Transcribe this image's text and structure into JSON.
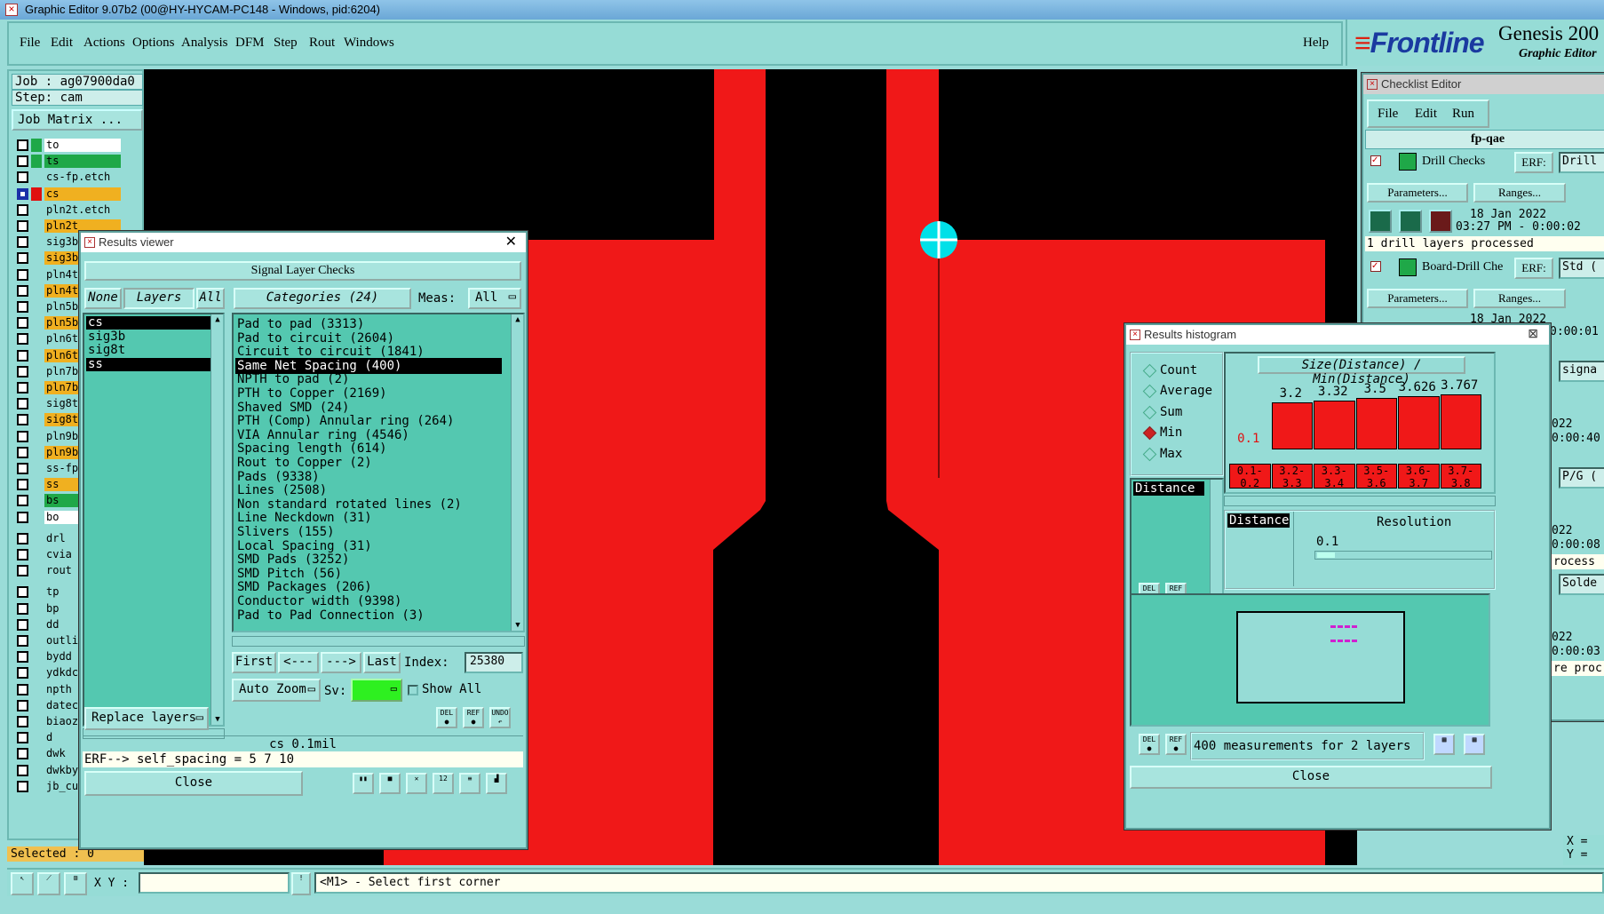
{
  "window": {
    "title": "Graphic Editor 9.07b2 (00@HY-HYCAM-PC148 - Windows, pid:6204)"
  },
  "menu": [
    "File",
    "Edit",
    "Actions",
    "Options",
    "Analysis",
    "DFM",
    "Step",
    "Rout",
    "Windows"
  ],
  "help": "Help",
  "logo": {
    "brand": "Frontline",
    "product": "Genesis 200",
    "subtitle": "Graphic Editor"
  },
  "job": {
    "job_label": "Job : ag07900da0",
    "step_label": "Step: cam",
    "matrix_button": "Job Matrix ..."
  },
  "layers": [
    {
      "name": "to",
      "color": "#ffffff",
      "ind": "#1fa848"
    },
    {
      "name": "ts",
      "color": "#1fa848",
      "ind": "#1fa848"
    },
    {
      "name": "cs-fp.etch",
      "color": "#96dcd6",
      "ind": "#96dcd6"
    },
    {
      "name": "cs",
      "color": "#f0b020",
      "ind": "#e01010",
      "active": true
    },
    {
      "name": "pln2t.etch",
      "color": "#96dcd6",
      "ind": "#96dcd6"
    },
    {
      "name": "pln2t",
      "color": "#f0b020",
      "ind": "#96dcd6"
    },
    {
      "name": "sig3b",
      "color": "#96dcd6",
      "ind": "#96dcd6"
    },
    {
      "name": "sig3b",
      "color": "#f0b020",
      "ind": "#96dcd6"
    },
    {
      "name": "pln4t",
      "color": "#96dcd6",
      "ind": "#96dcd6"
    },
    {
      "name": "pln4t",
      "color": "#f0b020",
      "ind": "#96dcd6"
    },
    {
      "name": "pln5b",
      "color": "#96dcd6",
      "ind": "#96dcd6"
    },
    {
      "name": "pln5b",
      "color": "#f0b020",
      "ind": "#96dcd6"
    },
    {
      "name": "pln6t",
      "color": "#96dcd6",
      "ind": "#96dcd6"
    },
    {
      "name": "pln6t",
      "color": "#f0b020",
      "ind": "#96dcd6"
    },
    {
      "name": "pln7b",
      "color": "#96dcd6",
      "ind": "#96dcd6"
    },
    {
      "name": "pln7b",
      "color": "#f0b020",
      "ind": "#96dcd6"
    },
    {
      "name": "sig8t",
      "color": "#96dcd6",
      "ind": "#96dcd6"
    },
    {
      "name": "sig8t",
      "color": "#f0b020",
      "ind": "#96dcd6"
    },
    {
      "name": "pln9b",
      "color": "#96dcd6",
      "ind": "#96dcd6"
    },
    {
      "name": "pln9b",
      "color": "#f0b020",
      "ind": "#96dcd6"
    },
    {
      "name": "ss-fp",
      "color": "#96dcd6",
      "ind": "#96dcd6"
    },
    {
      "name": "ss",
      "color": "#f0b020",
      "ind": "#96dcd6"
    },
    {
      "name": "bs",
      "color": "#1fa848",
      "ind": "#96dcd6"
    },
    {
      "name": "bo",
      "color": "#ffffff",
      "ind": "#96dcd6"
    },
    {
      "name": "drl",
      "color": "#96dcd6",
      "ind": "#96dcd6"
    },
    {
      "name": "cvia",
      "color": "#96dcd6",
      "ind": "#96dcd6"
    },
    {
      "name": "rout",
      "color": "#96dcd6",
      "ind": "#96dcd6"
    },
    {
      "name": "tp",
      "color": "#96dcd6",
      "ind": "#96dcd6"
    },
    {
      "name": "bp",
      "color": "#96dcd6",
      "ind": "#96dcd6"
    },
    {
      "name": "dd",
      "color": "#96dcd6",
      "ind": "#96dcd6"
    },
    {
      "name": "outli",
      "color": "#96dcd6",
      "ind": "#96dcd6"
    },
    {
      "name": "bydd",
      "color": "#96dcd6",
      "ind": "#96dcd6"
    },
    {
      "name": "ydkdc",
      "color": "#96dcd6",
      "ind": "#96dcd6"
    },
    {
      "name": "npth",
      "color": "#96dcd6",
      "ind": "#96dcd6"
    },
    {
      "name": "datec",
      "color": "#96dcd6",
      "ind": "#96dcd6"
    },
    {
      "name": "biaoz",
      "color": "#96dcd6",
      "ind": "#96dcd6"
    },
    {
      "name": "d",
      "color": "#96dcd6",
      "ind": "#96dcd6"
    },
    {
      "name": "dwk",
      "color": "#96dcd6",
      "ind": "#96dcd6"
    },
    {
      "name": "dwkby",
      "color": "#96dcd6",
      "ind": "#96dcd6"
    },
    {
      "name": "jb_cu",
      "color": "#96dcd6",
      "ind": "#96dcd6"
    }
  ],
  "selected": "Selected : 0",
  "results_viewer": {
    "title": "Results viewer",
    "header": "Signal Layer Checks",
    "none_btn": "None",
    "layers_btn": "Layers",
    "all_btn": "All",
    "categories_btn": "Categories (24)",
    "meas_label": "Meas:",
    "meas_value": "All",
    "layer_list": [
      "cs",
      "sig3b",
      "sig8t",
      "ss"
    ],
    "categories": [
      "Pad to pad (3313)",
      "Pad to circuit (2604)",
      "Circuit to circuit (1841)",
      "Same Net Spacing (400)",
      "NPTH to pad (2)",
      "PTH to Copper (2169)",
      "Shaved SMD (24)",
      "PTH (Comp) Annular ring (264)",
      "VIA Annular ring (4546)",
      "Spacing length (614)",
      "Rout to Copper (2)",
      "Pads (9338)",
      "Lines (2508)",
      "Non standard rotated lines (2)",
      "Line Neckdown (31)",
      "Slivers (155)",
      "Local Spacing (31)",
      "SMD Pads (3252)",
      "SMD Pitch (56)",
      "SMD Packages (206)",
      "Conductor width (9398)",
      "Pad to Pad Connection (3)"
    ],
    "first": "First",
    "prev": "<---",
    "next": "--->",
    "last": "Last",
    "index_label": "Index:",
    "index_value": "25380",
    "auto_zoom": "Auto Zoom",
    "sv_label": "Sv:",
    "show_all": "Show All",
    "replace_layers": "Replace layers",
    "status": "cs 0.1mil",
    "erf": "ERF--> self_spacing = 5 7 10",
    "close": "Close",
    "del": "DEL",
    "ref": "REF",
    "undo": "UNDO"
  },
  "histogram": {
    "title": "Results histogram",
    "modes": [
      "Count",
      "Average",
      "Sum",
      "Min",
      "Max"
    ],
    "selected_mode": "Min",
    "chart_title": "Size(Distance) / Min(Distance)",
    "list_label": "Distance",
    "distance_label": "Distance",
    "resolution_label": "Resolution",
    "resolution_value": "0.1",
    "footer": "400 measurements for 2 layers",
    "close": "Close",
    "del": "DEL",
    "ref": "REF"
  },
  "chart_data": {
    "type": "bar",
    "title": "Size(Distance) / Min(Distance)",
    "categories": [
      "0.1-\n0.2",
      "3.2-\n3.3",
      "3.3-\n3.4",
      "3.5-\n3.6",
      "3.6-\n3.7",
      "3.7-\n3.8"
    ],
    "values": [
      0.1,
      3.2,
      3.32,
      3.5,
      3.626,
      3.767
    ],
    "value_labels": [
      "0.1",
      "3.2",
      "3.32",
      "3.5",
      "3.626",
      "3.767"
    ],
    "ylim": [
      0,
      3.767
    ]
  },
  "checklist": {
    "title": "Checklist Editor",
    "menu": [
      "File",
      "Edit",
      "Run"
    ],
    "name": "fp-qae",
    "items": [
      {
        "name": "Drill Checks",
        "erf": "ERF:",
        "erf_value": "Drill",
        "params": "Parameters...",
        "ranges": "Ranges...",
        "date": "18 Jan 2022",
        "time": "03:27 PM - 0:00:02",
        "result": "1 drill layers processed"
      },
      {
        "name": "Board-Drill Che",
        "erf": "ERF:",
        "erf_value": "Std (",
        "params": "Parameters...",
        "ranges": "Ranges...",
        "date": "18 Jan 2022",
        "time": "0:00:01"
      }
    ],
    "partial": [
      "signa",
      "022",
      "0:00:40",
      "P/G (",
      "022",
      "0:00:08",
      "rocess",
      "Solde",
      "022",
      "0:00:03",
      "re proc"
    ]
  },
  "bottom": {
    "xy_label": "X Y :",
    "message": "<M1> - Select first corner",
    "x": "X =",
    "y": "Y ="
  },
  "colors": {
    "copper": "#f01818",
    "panel": "#96dcd6",
    "list": "#54c8b0",
    "highlight": "#f0b020",
    "marker": "#00e0e8"
  }
}
